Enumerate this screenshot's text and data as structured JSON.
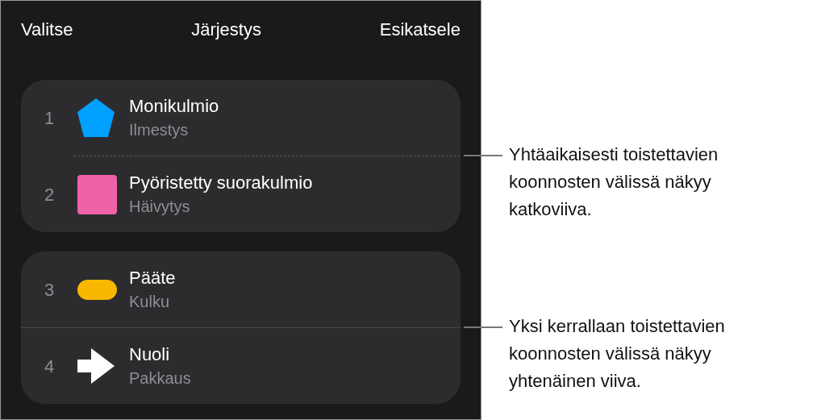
{
  "header": {
    "left_button": "Valitse",
    "title": "Järjestys",
    "right_button": "Esikatsele"
  },
  "groups": [
    {
      "kind": "dashed",
      "builds": [
        {
          "number": "1",
          "kind": "pentagon",
          "color": "#00a0ff",
          "title": "Monikulmio",
          "subtitle": "Ilmestys"
        },
        {
          "number": "2",
          "kind": "rounded-square",
          "color": "#f062a8",
          "title": "Pyöristetty suorakulmio",
          "subtitle": "Häivytys"
        }
      ]
    },
    {
      "kind": "solid",
      "builds": [
        {
          "number": "3",
          "kind": "capsule",
          "color": "#f8b800",
          "title": "Pääte",
          "subtitle": "Kulku"
        },
        {
          "number": "4",
          "kind": "arrow",
          "color": "#ffffff",
          "title": "Nuoli",
          "subtitle": "Pakkaus"
        }
      ]
    }
  ],
  "callouts": [
    {
      "text": "Yhtäaikaisesti toistettavien koonnosten välissä näkyy katkoviiva."
    },
    {
      "text": "Yksi kerrallaan toistettavien koonnosten välissä näkyy yhtenäinen viiva."
    }
  ]
}
